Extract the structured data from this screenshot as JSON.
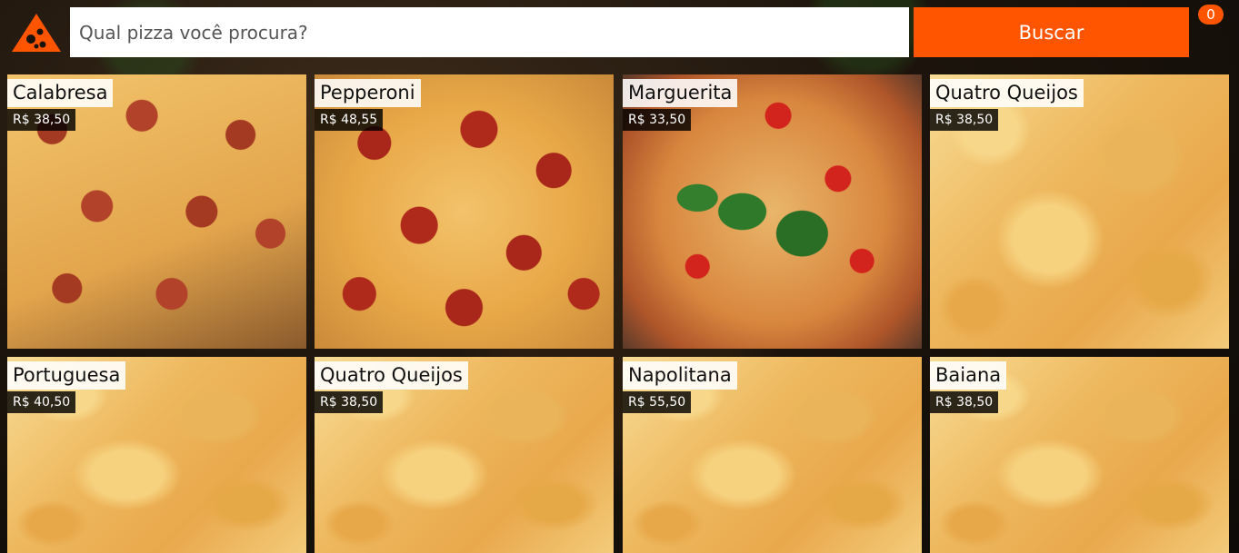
{
  "header": {
    "logo_icon": "pizza-slice-icon",
    "search_placeholder": "Qual pizza você procura?",
    "search_button_label": "Buscar",
    "cart_count": "0"
  },
  "colors": {
    "accent": "#ff5500",
    "price_bg": "#1a1a1a",
    "title_bg": "#ffffff"
  },
  "products": [
    {
      "name": "Calabresa",
      "price": "R$ 38,50",
      "image": "calabresa"
    },
    {
      "name": "Pepperoni",
      "price": "R$ 48,55",
      "image": "pepperoni"
    },
    {
      "name": "Marguerita",
      "price": "R$ 33,50",
      "image": "marguerita"
    },
    {
      "name": "Quatro Queijos",
      "price": "R$ 38,50",
      "image": "cheese"
    },
    {
      "name": "Portuguesa",
      "price": "R$ 40,50",
      "image": "cheese"
    },
    {
      "name": "Quatro Queijos",
      "price": "R$ 38,50",
      "image": "cheese"
    },
    {
      "name": "Napolitana",
      "price": "R$ 55,50",
      "image": "cheese"
    },
    {
      "name": "Baiana",
      "price": "R$ 38,50",
      "image": "cheese"
    }
  ]
}
